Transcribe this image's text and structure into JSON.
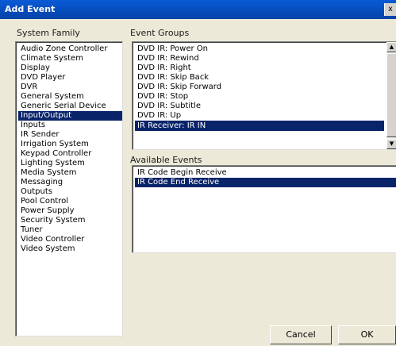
{
  "window": {
    "title": "Add Event",
    "close_glyph": "x"
  },
  "system_family": {
    "label": "System Family",
    "items": [
      "Audio Zone Controller",
      "Climate System",
      "Display",
      "DVD Player",
      "DVR",
      "General System",
      "Generic Serial Device",
      "Input/Output",
      "Inputs",
      "IR Sender",
      "Irrigation System",
      "Keypad Controller",
      "Lighting System",
      "Media System",
      "Messaging",
      "Outputs",
      "Pool Control",
      "Power Supply",
      "Security System",
      "Tuner",
      "Video Controller",
      "Video System"
    ],
    "selected": "Input/Output"
  },
  "event_groups": {
    "label": "Event Groups",
    "items": [
      "DVD IR: Power On",
      "DVD IR: Rewind",
      "DVD IR: Right",
      "DVD IR: Skip Back",
      "DVD IR: Skip Forward",
      "DVD IR: Stop",
      "DVD IR: Subtitle",
      "DVD IR: Up",
      "IR Receiver: IR IN"
    ],
    "selected": "IR Receiver: IR IN"
  },
  "available_events": {
    "label": "Available Events",
    "items": [
      "IR Code Begin Receive",
      "IR Code End Receive"
    ],
    "selected": "IR Code End Receive"
  },
  "buttons": {
    "cancel": "Cancel",
    "ok": "OK"
  },
  "scrollbar": {
    "up_glyph": "▲",
    "down_glyph": "▼"
  },
  "colors": {
    "selection": "#0a246a",
    "titlebar": "#0a5bd6"
  }
}
